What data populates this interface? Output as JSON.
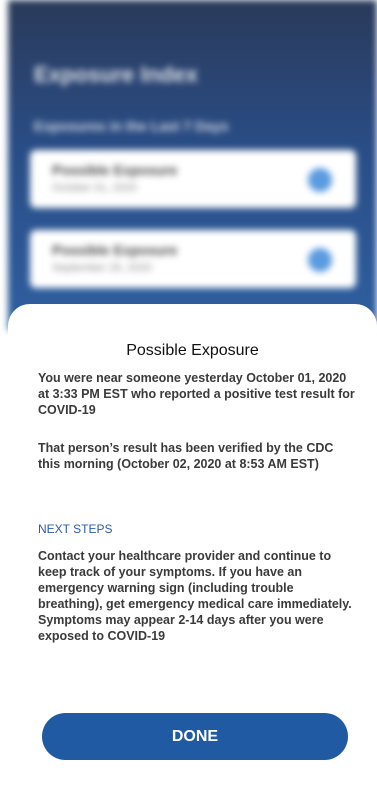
{
  "background": {
    "title": "Exposure Index",
    "subtitle": "Exposures in the Last 7 Days",
    "cards": [
      {
        "title": "Possible Exposure",
        "date": "October 01, 2020"
      },
      {
        "title": "Possible Exposure",
        "date": "September 29, 2020"
      }
    ]
  },
  "sheet": {
    "title": "Possible Exposure",
    "paragraph1": "You were near someone yesterday October 01, 2020 at 3:33 PM EST who reported a positive test result for COVID-19",
    "paragraph2": "That person’s result has been verified by the CDC this morning (October 02, 2020 at 8:53 AM EST)",
    "next_steps_heading": "NEXT STEPS",
    "paragraph3": "Contact your healthcare provider and continue to keep track of your symptoms. If you have an emergency warning sign (including trouble breathing), get emergency medical care immediately. Symptoms may appear 2-14 days after you were exposed to COVID-19",
    "done_label": "DONE"
  },
  "colors": {
    "primary_blue": "#1f5aa3",
    "link_blue": "#2a5ca8",
    "text": "#3a3a3a"
  }
}
